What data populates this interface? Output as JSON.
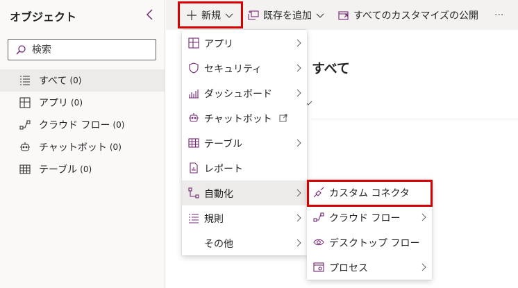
{
  "sidebar": {
    "title": "オブジェクト",
    "search_placeholder": "検索",
    "items": [
      {
        "label": "すべて",
        "count": "(0)",
        "icon": "list-icon"
      },
      {
        "label": "アプリ",
        "count": "(0)",
        "icon": "app-icon"
      },
      {
        "label": "クラウド フロー",
        "count": "(0)",
        "icon": "flow-icon"
      },
      {
        "label": "チャットボット",
        "count": "(0)",
        "icon": "bot-icon"
      },
      {
        "label": "テーブル",
        "count": "(0)",
        "icon": "table-icon"
      }
    ]
  },
  "toolbar": {
    "new_label": "新規",
    "add_existing_label": "既存を追加",
    "publish_label": "すべてのカスタマイズの公開",
    "more_label": "···"
  },
  "main": {
    "title": "すべて"
  },
  "new_menu": {
    "items": [
      {
        "label": "アプリ",
        "icon": "app-icon",
        "has_submenu": true
      },
      {
        "label": "セキュリティ",
        "icon": "shield-icon",
        "has_submenu": true
      },
      {
        "label": "ダッシュボード",
        "icon": "dashboard-icon",
        "has_submenu": true
      },
      {
        "label": "チャットボット",
        "icon": "bot-icon",
        "has_submenu": false,
        "external": true
      },
      {
        "label": "テーブル",
        "icon": "table-icon",
        "has_submenu": true
      },
      {
        "label": "レポート",
        "icon": "report-icon",
        "has_submenu": false
      },
      {
        "label": "自動化",
        "icon": "automation-icon",
        "has_submenu": true,
        "highlighted": true
      },
      {
        "label": "規則",
        "icon": "rules-icon",
        "has_submenu": true
      },
      {
        "label": "その他",
        "icon": "",
        "has_submenu": true
      }
    ]
  },
  "automation_menu": {
    "items": [
      {
        "label": "カスタム コネクタ",
        "icon": "connector-icon",
        "has_submenu": false
      },
      {
        "label": "クラウド フロー",
        "icon": "flow-icon",
        "has_submenu": true
      },
      {
        "label": "デスクトップ フロー",
        "icon": "eye-icon",
        "has_submenu": false
      },
      {
        "label": "プロセス",
        "icon": "process-icon",
        "has_submenu": true
      }
    ]
  },
  "colors": {
    "accent": "#742774",
    "highlight_border": "#d70000",
    "sidebar_bg": "#faf9f8",
    "toolbar_bg": "#f3f2f1",
    "selected_bg": "#edebe9"
  }
}
